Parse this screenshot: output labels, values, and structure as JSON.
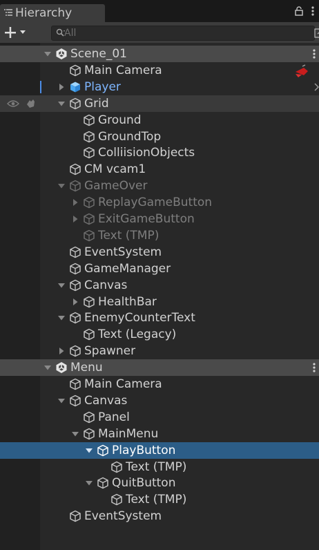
{
  "window": {
    "tab_label": "Hierarchy"
  },
  "toolbar": {
    "search_placeholder": "All"
  },
  "colors": {
    "accent_blue": "#7eb6ff",
    "selection": "#2c5d87",
    "prefab_bar": "#4c8ee8",
    "panel_bg": "#282828"
  },
  "tree": [
    {
      "label": "Scene_01",
      "depth": 0,
      "expanded": true,
      "kind": "scene",
      "icon": "unity-scene-icon"
    },
    {
      "label": "Main Camera",
      "depth": 1,
      "kind": "go",
      "icon": "gameobject-icon",
      "badge": "camera-gizmo-icon"
    },
    {
      "label": "Player",
      "depth": 1,
      "expanded": false,
      "kind": "prefab",
      "icon": "prefab-icon"
    },
    {
      "label": "Grid",
      "depth": 1,
      "expanded": true,
      "kind": "go",
      "icon": "gameobject-icon",
      "row_tools": true
    },
    {
      "label": "Ground",
      "depth": 2,
      "kind": "go",
      "icon": "gameobject-icon"
    },
    {
      "label": "GroundTop",
      "depth": 2,
      "kind": "go",
      "icon": "gameobject-icon"
    },
    {
      "label": "ColliisionObjects",
      "depth": 2,
      "kind": "go",
      "icon": "gameobject-icon"
    },
    {
      "label": "CM vcam1",
      "depth": 1,
      "kind": "go",
      "icon": "gameobject-icon"
    },
    {
      "label": "GameOver",
      "depth": 1,
      "expanded": true,
      "kind": "inactive",
      "icon": "gameobject-icon"
    },
    {
      "label": "ReplayGameButton",
      "depth": 2,
      "expanded": false,
      "kind": "inactive",
      "icon": "gameobject-icon"
    },
    {
      "label": "ExitGameButton",
      "depth": 2,
      "expanded": false,
      "kind": "inactive",
      "icon": "gameobject-icon"
    },
    {
      "label": "Text (TMP)",
      "depth": 2,
      "kind": "inactive",
      "icon": "gameobject-icon"
    },
    {
      "label": "EventSystem",
      "depth": 1,
      "kind": "go",
      "icon": "gameobject-icon"
    },
    {
      "label": "GameManager",
      "depth": 1,
      "kind": "go",
      "icon": "gameobject-icon"
    },
    {
      "label": "Canvas",
      "depth": 1,
      "expanded": true,
      "kind": "go",
      "icon": "gameobject-icon"
    },
    {
      "label": "HealthBar",
      "depth": 2,
      "expanded": false,
      "kind": "go",
      "icon": "gameobject-icon"
    },
    {
      "label": "EnemyCounterText",
      "depth": 1,
      "expanded": true,
      "kind": "go",
      "icon": "gameobject-icon"
    },
    {
      "label": "Text (Legacy)",
      "depth": 2,
      "kind": "go",
      "icon": "gameobject-icon"
    },
    {
      "label": "Spawner",
      "depth": 1,
      "expanded": false,
      "kind": "go",
      "icon": "gameobject-icon"
    },
    {
      "label": "Menu",
      "depth": 0,
      "expanded": true,
      "kind": "scene",
      "icon": "unity-scene-icon"
    },
    {
      "label": "Main Camera",
      "depth": 1,
      "kind": "go",
      "icon": "gameobject-icon"
    },
    {
      "label": "Canvas",
      "depth": 1,
      "expanded": true,
      "kind": "go",
      "icon": "gameobject-icon"
    },
    {
      "label": "Panel",
      "depth": 2,
      "kind": "go",
      "icon": "gameobject-icon"
    },
    {
      "label": "MainMenu",
      "depth": 2,
      "expanded": true,
      "kind": "go",
      "icon": "gameobject-icon"
    },
    {
      "label": "PlayButton",
      "depth": 3,
      "expanded": true,
      "kind": "go",
      "icon": "gameobject-icon",
      "selected": true
    },
    {
      "label": "Text (TMP)",
      "depth": 4,
      "kind": "go",
      "icon": "gameobject-icon"
    },
    {
      "label": "QuitButton",
      "depth": 3,
      "expanded": true,
      "kind": "go",
      "icon": "gameobject-icon"
    },
    {
      "label": "Text (TMP)",
      "depth": 4,
      "kind": "go",
      "icon": "gameobject-icon"
    },
    {
      "label": "EventSystem",
      "depth": 1,
      "kind": "go",
      "icon": "gameobject-icon"
    }
  ]
}
